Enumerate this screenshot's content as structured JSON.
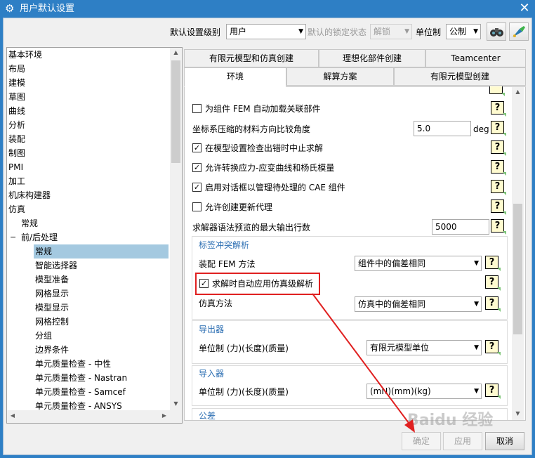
{
  "window": {
    "title": "用户默认设置",
    "close_glyph": "✕"
  },
  "toolbar": {
    "level_label": "默认设置级别",
    "level_value": "用户",
    "lock_label": "默认的锁定状态",
    "lock_value": "解锁",
    "unit_label": "单位制",
    "unit_value": "公制"
  },
  "tree": {
    "items": [
      "基本环境",
      "布局",
      "建模",
      "草图",
      "曲线",
      "分析",
      "装配",
      "制图",
      "PMI",
      "加工",
      "机床构建器",
      "仿真",
      "常规",
      "前/后处理",
      "常规",
      "智能选择器",
      "模型准备",
      "网格显示",
      "模型显示",
      "网格控制",
      "分组",
      "边界条件",
      "单元质量检查 - 中性",
      "单元质量检查 - Nastran",
      "单元质量检查 - Samcef",
      "单元质量检查 - ANSYS"
    ],
    "expander": "−"
  },
  "tabs": {
    "row1": [
      "有限元模型和仿真创建",
      "理想化部件创建",
      "Teamcenter"
    ],
    "row2": [
      "环境",
      "解算方案",
      "有限元模型创建"
    ]
  },
  "panel": {
    "auto_load_fem": {
      "label": "为组件 FEM 自动加载关联部件",
      "checked": false
    },
    "angle": {
      "label": "坐标系压缩的材料方向比较角度",
      "value": "5.0",
      "unit": "deg"
    },
    "stop_on_error": {
      "label": "在模型设置检查出错时中止求解",
      "checked": true
    },
    "allow_stress": {
      "label": "允许转换应力-应变曲线和杨氏模量",
      "checked": true
    },
    "enable_cae": {
      "label": "启用对话框以管理待处理的 CAE 组件",
      "checked": true
    },
    "allow_proxy": {
      "label": "允许创建更新代理",
      "checked": false
    },
    "max_lines": {
      "label": "求解器语法预览的最大输出行数",
      "value": "5000"
    },
    "label_conflict": {
      "title": "标签冲突解析",
      "assembly_label": "装配 FEM 方法",
      "assembly_value": "组件中的偏差相同",
      "auto_apply": {
        "label": "求解时自动应用仿真级解析",
        "checked": true
      },
      "sim_label": "仿真方法",
      "sim_value": "仿真中的偏差相同"
    },
    "exporter": {
      "title": "导出器",
      "unit_label": "单位制 (力)(长度)(质量)",
      "unit_value": "有限元模型单位"
    },
    "importer": {
      "title": "导入器",
      "unit_label": "单位制 (力)(长度)(质量)",
      "unit_value": "(mN)(mm)(kg)"
    },
    "tolerance": {
      "title": "公差"
    },
    "help_glyph": "?",
    "check_glyph": "✓"
  },
  "buttons": {
    "ok": "确定",
    "apply": "应用",
    "cancel": "取消"
  },
  "watermark": "Baidu 经验",
  "colors": {
    "titlebar": "#2e7fc5",
    "highlight": "#e02020",
    "selection": "#a4c9e0",
    "help_bg": "#fffbd0"
  }
}
